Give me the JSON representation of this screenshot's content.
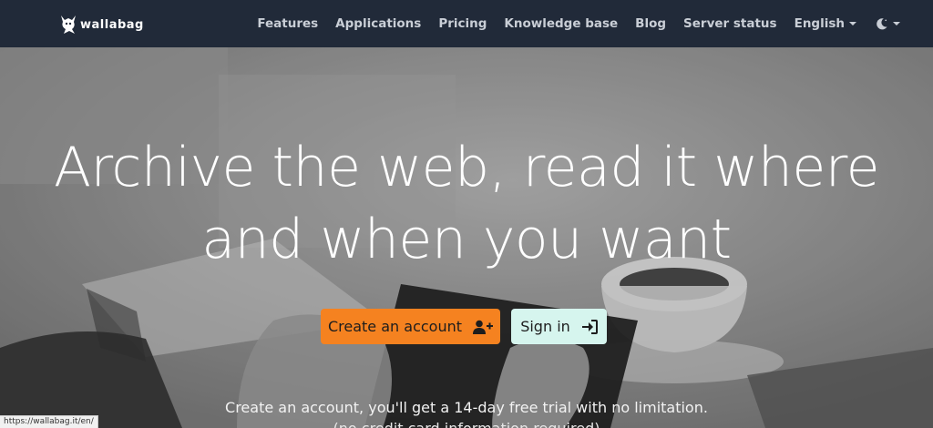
{
  "brand": {
    "name": "wallabag"
  },
  "nav": {
    "items": [
      {
        "label": "Features"
      },
      {
        "label": "Applications"
      },
      {
        "label": "Pricing"
      },
      {
        "label": "Knowledge base"
      },
      {
        "label": "Blog"
      },
      {
        "label": "Server status"
      }
    ],
    "language": "English",
    "theme_icon": "moon-icon"
  },
  "hero": {
    "headline_line1": "Archive the web, read it where",
    "headline_line2": "and when you want",
    "create_account_label": "Create an account",
    "create_account_icon": "user-plus-icon",
    "sign_in_label": "Sign in",
    "sign_in_icon": "sign-in-icon",
    "trial_text": "Create an account, you'll get a 14-day free trial with no limitation.",
    "trial_text_2": "(no credit card information required)"
  },
  "status_bar": {
    "url": "https://wallabag.it/en/"
  },
  "colors": {
    "navbar_bg": "#212a39",
    "create_button": "#f58220",
    "signin_button": "#d6f5ee"
  }
}
